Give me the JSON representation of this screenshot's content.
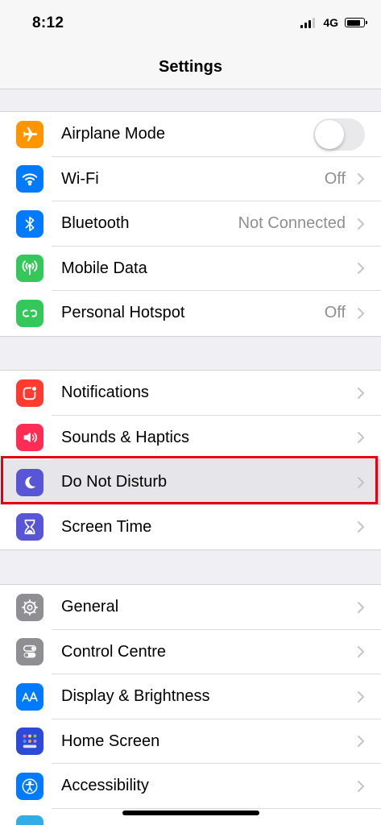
{
  "status": {
    "time": "8:12",
    "network": "4G"
  },
  "header": {
    "title": "Settings"
  },
  "groups": [
    {
      "rows": [
        {
          "label": "Airplane Mode",
          "control": "toggle",
          "toggle_on": false,
          "icon": "airplane-icon",
          "color": "#ff9500"
        },
        {
          "label": "Wi-Fi",
          "value": "Off",
          "icon": "wifi-icon",
          "color": "#007aff"
        },
        {
          "label": "Bluetooth",
          "value": "Not Connected",
          "icon": "bluetooth-icon",
          "color": "#007aff"
        },
        {
          "label": "Mobile Data",
          "value": "",
          "icon": "antenna-icon",
          "color": "#34c759"
        },
        {
          "label": "Personal Hotspot",
          "value": "Off",
          "icon": "hotspot-icon",
          "color": "#34c759"
        }
      ]
    },
    {
      "rows": [
        {
          "label": "Notifications",
          "value": "",
          "icon": "notifications-icon",
          "color": "#ff3b30"
        },
        {
          "label": "Sounds & Haptics",
          "value": "",
          "icon": "speaker-icon",
          "color": "#ff2d55"
        },
        {
          "label": "Do Not Disturb",
          "value": "",
          "icon": "moon-icon",
          "color": "#5856d6",
          "highlighted": true
        },
        {
          "label": "Screen Time",
          "value": "",
          "icon": "hourglass-icon",
          "color": "#5856d6"
        }
      ]
    },
    {
      "rows": [
        {
          "label": "General",
          "value": "",
          "icon": "gear-icon",
          "color": "#8e8e93"
        },
        {
          "label": "Control Centre",
          "value": "",
          "icon": "switches-icon",
          "color": "#8e8e93"
        },
        {
          "label": "Display & Brightness",
          "value": "",
          "icon": "text-size-icon",
          "color": "#007aff"
        },
        {
          "label": "Home Screen",
          "value": "",
          "icon": "home-grid-icon",
          "color": "#2c49d8"
        },
        {
          "label": "Accessibility",
          "value": "",
          "icon": "accessibility-icon",
          "color": "#007aff"
        }
      ]
    }
  ]
}
